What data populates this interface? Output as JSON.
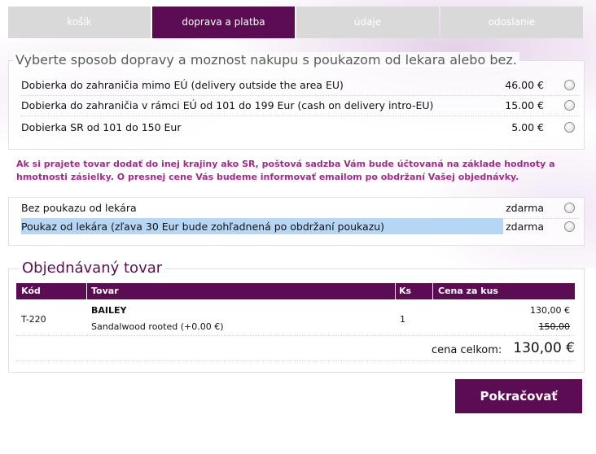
{
  "tabs": [
    {
      "label": "košík"
    },
    {
      "label": "doprava a platba"
    },
    {
      "label": "údaje"
    },
    {
      "label": "odoslanie"
    }
  ],
  "shipping": {
    "title": "Vyberte sposob dopravy a moznost nakupu s poukazom od lekara alebo bez.",
    "options": [
      {
        "label": "Dobierka do zahraničia mimo EÚ (delivery outside the area EU)",
        "price": "46.00 €"
      },
      {
        "label": "Dobierka do zahraničia v rámci EÚ od 101 do 199 Eur (cash on delivery intro-EU)",
        "price": "15.00 €"
      },
      {
        "label": "Dobierka SR od 101 do 150 Eur",
        "price": "5.00 €"
      }
    ]
  },
  "note": "Ak si prajete tovar dodať do inej krajiny ako SR, poštová sadzba Vám bude účtovaná na základe hodnoty a hmotnosti zásielky. O presnej cene Vás budeme informovať emailom po obdržaní Vašej objednávky.",
  "voucher": {
    "options": [
      {
        "label": "Bez poukazu od lekára",
        "price": "zdarma"
      },
      {
        "label": "Poukaz od lekára (zľava 30 Eur bude zohľadnená po obdržaní poukazu)",
        "price": "zdarma"
      }
    ]
  },
  "order": {
    "title": "Objednávaný tovar",
    "columns": {
      "code": "Kód",
      "item": "Tovar",
      "qty": "Ks",
      "price": "Cena za kus"
    },
    "rows": [
      {
        "code": "T-220",
        "name": "BAILEY",
        "variant": "Sandalwood rooted (+0.00 €)",
        "qty": "1",
        "price": "130,00  €",
        "old_price": "150,00"
      }
    ],
    "total_label": "cena celkom:",
    "total_value": "130,00 €"
  },
  "continue_label": "Pokračovať",
  "colors": {
    "accent": "#5c0c52",
    "note": "#a6288f",
    "tab_inactive": "#d9d9d9",
    "highlight": "#b6d6f5"
  }
}
